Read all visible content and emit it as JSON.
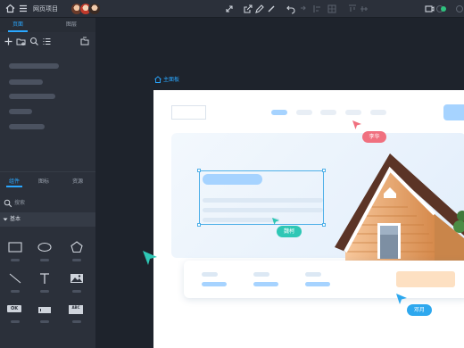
{
  "topbar": {
    "project_title": "网页项目",
    "avatars": [
      "avatar-1",
      "avatar-2",
      "avatar-3"
    ],
    "status": "online"
  },
  "sidebar": {
    "tabs": [
      {
        "label": "页面",
        "active": true
      },
      {
        "label": "图层",
        "active": false
      }
    ],
    "component_tabs": [
      {
        "label": "组件",
        "active": true
      },
      {
        "label": "图标",
        "active": false
      },
      {
        "label": "资源",
        "active": false
      }
    ],
    "search_placeholder": "搜索",
    "section_label": "基本",
    "components": [
      "rectangle",
      "ellipse",
      "pentagon",
      "line",
      "text",
      "image",
      "ok-button",
      "input",
      "abc-text-block"
    ],
    "components_ok_label": "OK",
    "components_abc_label": "ABC"
  },
  "canvas": {
    "board_label": "主面板",
    "collaborators": [
      {
        "name": "李华",
        "color": "#f0707f"
      },
      {
        "name": "魏柯",
        "color": "#2ec7b5"
      },
      {
        "name": "邓月",
        "color": "#2ea8ee"
      }
    ]
  },
  "colors": {
    "accent": "#2aa7ff",
    "sidebar": "#2b303a",
    "canvas": "#1e232c"
  }
}
